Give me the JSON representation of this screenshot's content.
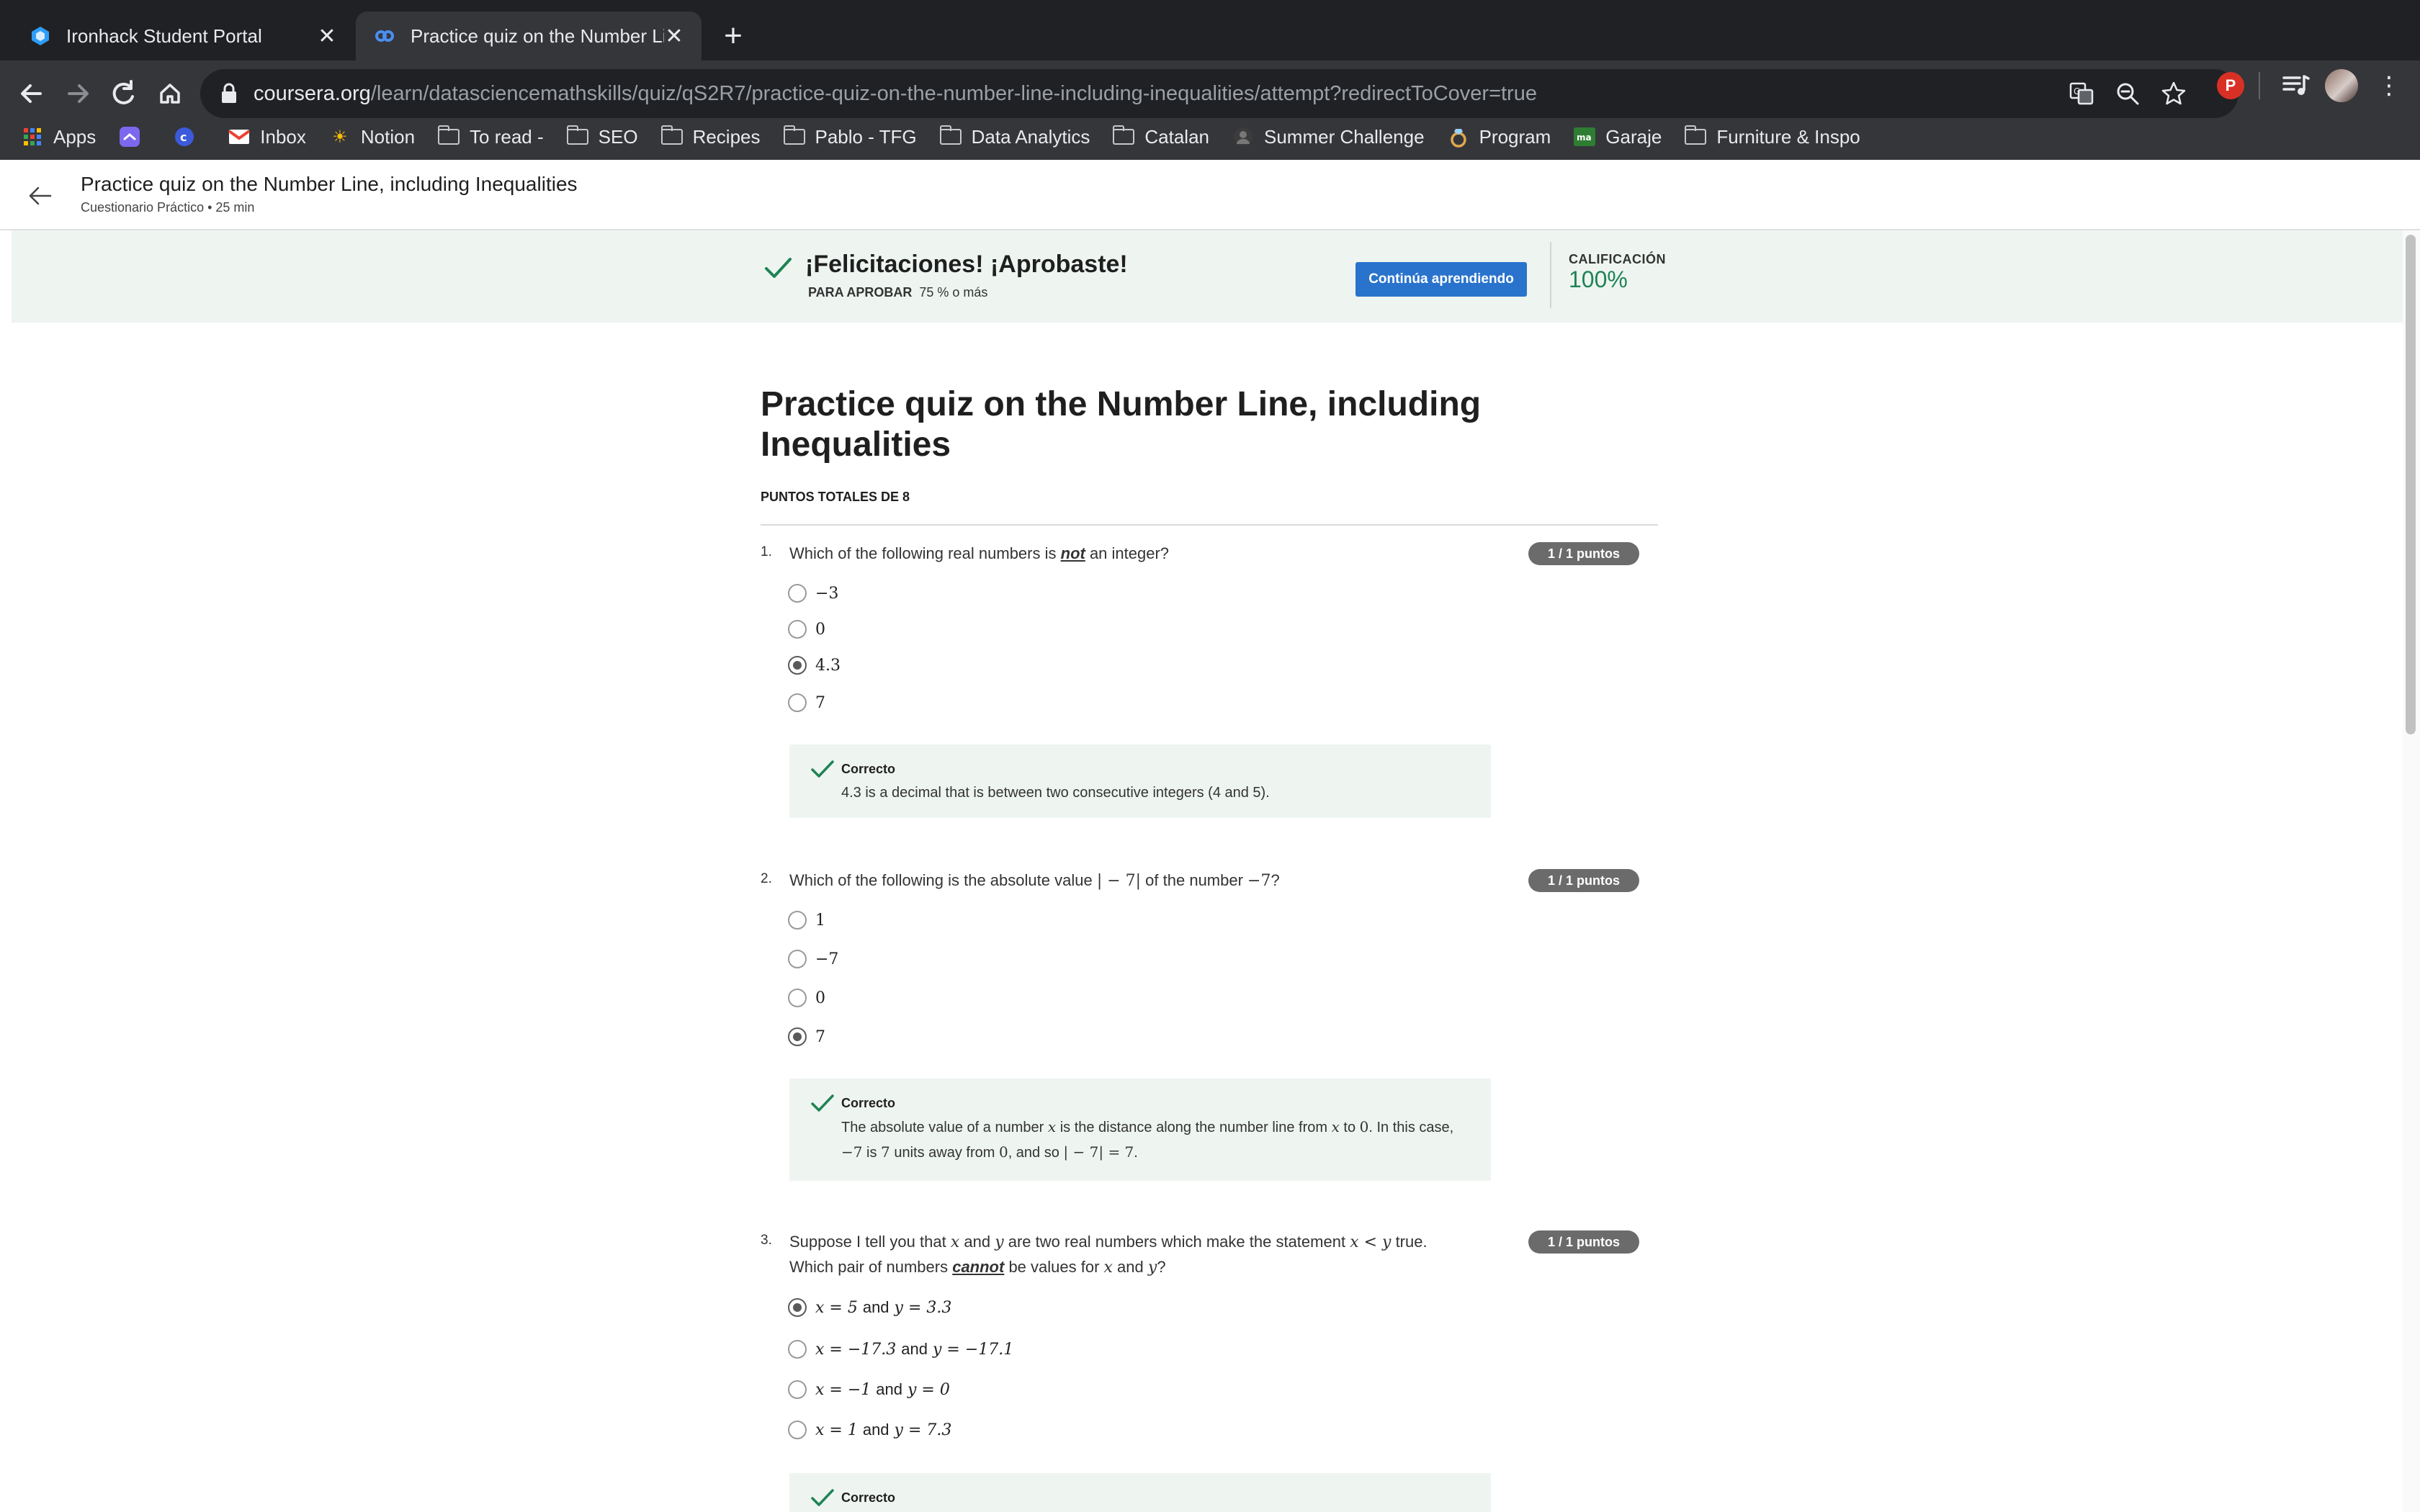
{
  "browser": {
    "tabs": [
      {
        "label": "Ironhack Student Portal",
        "active": false
      },
      {
        "label": "Practice quiz on the Number Line, including Inequalities",
        "active": true
      }
    ],
    "url_host": "coursera.org",
    "url_path": "/learn/datasciencemathskills/quiz/qS2R7/practice-quiz-on-the-number-line-including-inequalities/attempt?redirectToCover=true",
    "profile_initial": "P",
    "bookmarks": [
      {
        "label": "Apps",
        "icon": "apps-grid-icon"
      },
      {
        "label": "",
        "icon": "clickup-icon"
      },
      {
        "label": "",
        "icon": "extension-c-icon"
      },
      {
        "label": "Inbox",
        "icon": "gmail-icon"
      },
      {
        "label": "Notion",
        "icon": "sun-icon"
      },
      {
        "label": "To read -",
        "icon": "folder-icon"
      },
      {
        "label": "SEO",
        "icon": "folder-icon"
      },
      {
        "label": "Recipes",
        "icon": "folder-icon"
      },
      {
        "label": "Pablo - TFG",
        "icon": "folder-icon"
      },
      {
        "label": "Data Analytics",
        "icon": "folder-icon"
      },
      {
        "label": "Catalan",
        "icon": "folder-icon"
      },
      {
        "label": "Summer Challenge",
        "icon": "avatar-icon"
      },
      {
        "label": "Program",
        "icon": "ring-icon"
      },
      {
        "label": "Garaje",
        "icon": "ma-icon"
      },
      {
        "label": "Furniture & Inspo",
        "icon": "folder-icon"
      }
    ]
  },
  "header": {
    "title": "Practice quiz on the Number Line, including Inequalities",
    "subtitle": "Cuestionario Práctico • 25 min"
  },
  "banner": {
    "title": "¡Felicitaciones! ¡Aprobaste!",
    "pass_label": "PARA APROBAR",
    "pass_value": "75 % o más",
    "button": "Continúa aprendiendo",
    "grade_label": "CALIFICACIÓN",
    "grade_value": "100%",
    "accent": "#1f8354",
    "button_color": "#2a73cc"
  },
  "quiz": {
    "title": "Practice quiz on the Number Line, including Inequalities",
    "totals": "PUNTOS TOTALES DE 8",
    "feedback_label": "Correcto",
    "questions": [
      {
        "number": "1.",
        "text_pre": "Which of the following real numbers is ",
        "text_em": "not",
        "text_post": " an integer?",
        "points": "1 / 1 puntos",
        "options": [
          "−3",
          "0",
          "4.3",
          "7"
        ],
        "selected": 2,
        "feedback": "4.3 is a decimal that is between two consecutive integers (4 and 5)."
      },
      {
        "number": "2.",
        "text_a": "Which of the following is the absolute value ",
        "text_math1": "| − 7|",
        "text_b": " of the number ",
        "text_math2": "−7",
        "text_c": "?",
        "points": "1 / 1 puntos",
        "options": [
          "1",
          "−7",
          "0",
          "7"
        ],
        "selected": 3,
        "feedback_l1a": "The absolute value of a number ",
        "feedback_l1m1": "x",
        "feedback_l1b": " is the distance along the number line from ",
        "feedback_l1m2": "x",
        "feedback_l1c": " to ",
        "feedback_l1m3": "0",
        "feedback_l1d": ". In this case,",
        "feedback_l2m1": "−7",
        "feedback_l2a": " is ",
        "feedback_l2m2": "7",
        "feedback_l2b": " units away from ",
        "feedback_l2m3": "0",
        "feedback_l2c": ", and so ",
        "feedback_l2m4": "| − 7| = 7",
        "feedback_l2d": "."
      },
      {
        "number": "3.",
        "l1a": "Suppose I tell you that ",
        "l1m1": "x",
        "l1b": " and ",
        "l1m2": "y",
        "l1c": " are two real numbers which make the statement ",
        "l1m3": "x < y",
        "l1d": " true.",
        "l2a": "Which pair of numbers ",
        "l2em": "cannot",
        "l2b": " be values for ",
        "l2m1": "x",
        "l2c": " and ",
        "l2m2": "y",
        "l2d": "?",
        "points": "1 / 1 puntos",
        "options": [
          {
            "x": "x = 5",
            "y": "y = 3.3"
          },
          {
            "x": "x = −17.3",
            "y": "y = −17.1"
          },
          {
            "x": "x = −1",
            "y": "y = 0"
          },
          {
            "x": "x = 1",
            "y": "y = 7.3"
          }
        ],
        "and_word": "and",
        "selected": 0
      }
    ]
  }
}
